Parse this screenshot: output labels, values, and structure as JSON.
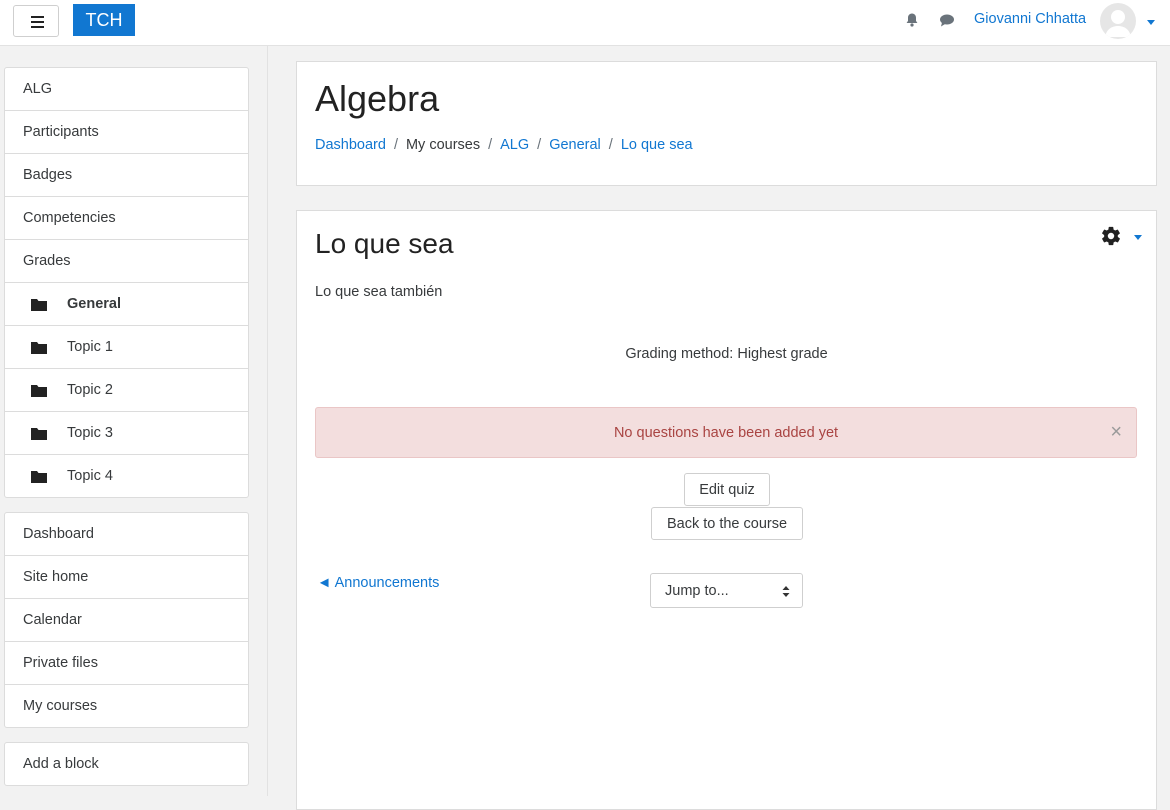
{
  "navbar": {
    "brand": "TCH",
    "user_name": "Giovanni Chhatta",
    "icons": [
      "menu-icon",
      "bell-icon",
      "chat-icon",
      "avatar",
      "chevron-down-icon"
    ]
  },
  "drawer": {
    "course_nav": [
      {
        "label": "ALG"
      },
      {
        "label": "Participants"
      },
      {
        "label": "Badges"
      },
      {
        "label": "Competencies"
      },
      {
        "label": "Grades"
      },
      {
        "label": "General",
        "icon": "folder-icon",
        "active": true
      },
      {
        "label": "Topic 1",
        "icon": "folder-icon"
      },
      {
        "label": "Topic 2",
        "icon": "folder-icon"
      },
      {
        "label": "Topic 3",
        "icon": "folder-icon"
      },
      {
        "label": "Topic 4",
        "icon": "folder-icon"
      }
    ],
    "site_nav": [
      {
        "label": "Dashboard"
      },
      {
        "label": "Site home"
      },
      {
        "label": "Calendar"
      },
      {
        "label": "Private files"
      },
      {
        "label": "My courses"
      }
    ],
    "add_block": "Add a block"
  },
  "header": {
    "title": "Algebra",
    "breadcrumb": [
      "Dashboard",
      "My courses",
      "ALG",
      "General",
      "Lo que sea"
    ]
  },
  "main": {
    "title": "Lo que sea",
    "intro": "Lo que sea también",
    "grading_method": "Grading method: Highest grade",
    "alert": "No questions have been added yet",
    "alert_close": "×",
    "edit_quiz": "Edit quiz",
    "back_to_course": "Back to the course",
    "prev_activity": "◄ Announcements",
    "jump_to": "Jump to..."
  },
  "colors": {
    "brand": "#1177d1",
    "alert_bg": "#f3dede",
    "alert_text": "#a94442"
  }
}
